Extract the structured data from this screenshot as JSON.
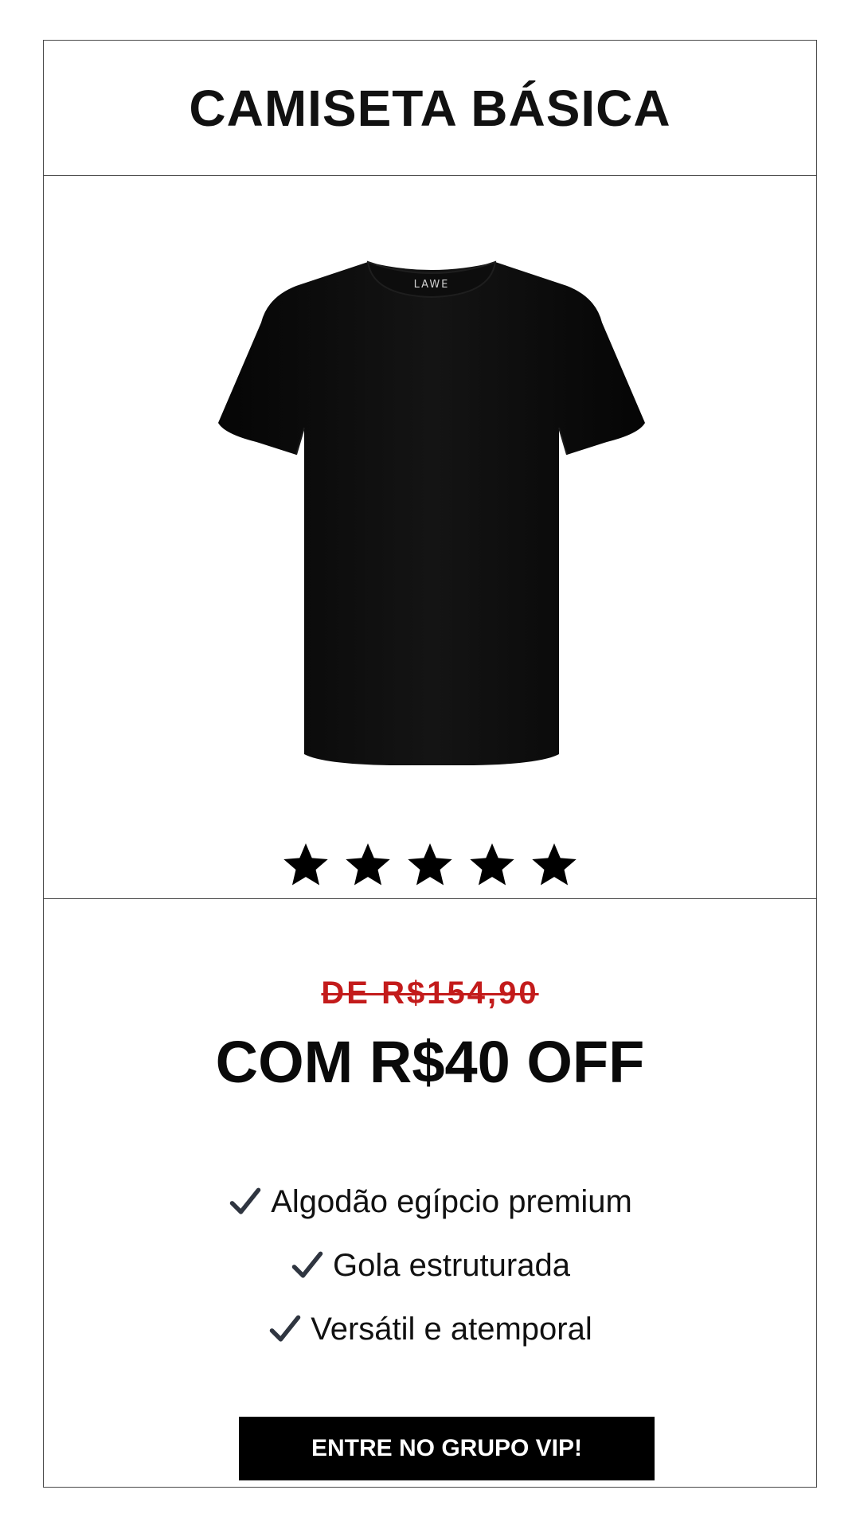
{
  "product": {
    "title": "CAMISETA BÁSICA",
    "brand_label": "LAWE",
    "image_icon": "black-tshirt-image"
  },
  "rating": {
    "value": 5,
    "max": 5,
    "icon": "star-icon"
  },
  "offer": {
    "old_price": "DE R$154,90",
    "discount": "COM R$40 OFF"
  },
  "features": [
    "Algodão egípcio premium",
    "Gola estruturada",
    "Versátil e atemporal"
  ],
  "feature_icon": "checkmark-icon",
  "cta": {
    "label": "ENTRE NO GRUPO VIP!"
  },
  "colors": {
    "old_price": "#c31b1b",
    "button_bg": "#000000",
    "button_text": "#ffffff",
    "border": "#4a4a4a"
  }
}
